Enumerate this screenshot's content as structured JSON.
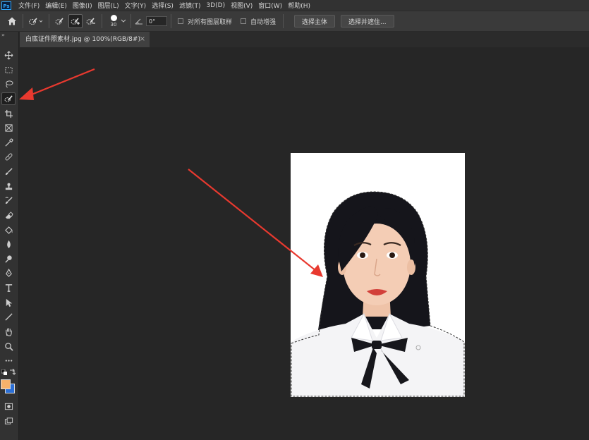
{
  "app": {
    "logo": "Ps"
  },
  "menubar": {
    "items": [
      "文件(F)",
      "编辑(E)",
      "图像(I)",
      "图层(L)",
      "文字(Y)",
      "选择(S)",
      "滤镜(T)",
      "3D(D)",
      "视图(V)",
      "窗口(W)",
      "帮助(H)"
    ]
  },
  "options": {
    "brush_size": "30",
    "angle": "0°",
    "sample_all_layers": "对所有图层取样",
    "auto_enhance": "自动增强",
    "select_subject": "选择主体",
    "select_and_mask": "选择并遮住..."
  },
  "document_tab": {
    "title": "白底证件照素材.jpg @ 100%(RGB/8#)",
    "close": "×"
  },
  "toolbar": {
    "collapse": "»",
    "tools": [
      "move-tool",
      "marquee-tool",
      "lasso-tool",
      "quick-selection-tool",
      "crop-tool",
      "frame-tool",
      "eyedropper-tool",
      "healing-brush-tool",
      "brush-tool",
      "clone-stamp-tool",
      "history-brush-tool",
      "eraser-tool",
      "paint-bucket-tool",
      "blur-tool",
      "dodge-tool",
      "pen-tool",
      "type-tool",
      "path-selection-tool",
      "line-tool",
      "hand-tool",
      "zoom-tool",
      "more-tools"
    ],
    "active_tool": "quick-selection-tool"
  },
  "colors": {
    "foreground": "#f6b26b",
    "background": "#2b6fd6",
    "annotation_arrow": "#e8392f"
  }
}
